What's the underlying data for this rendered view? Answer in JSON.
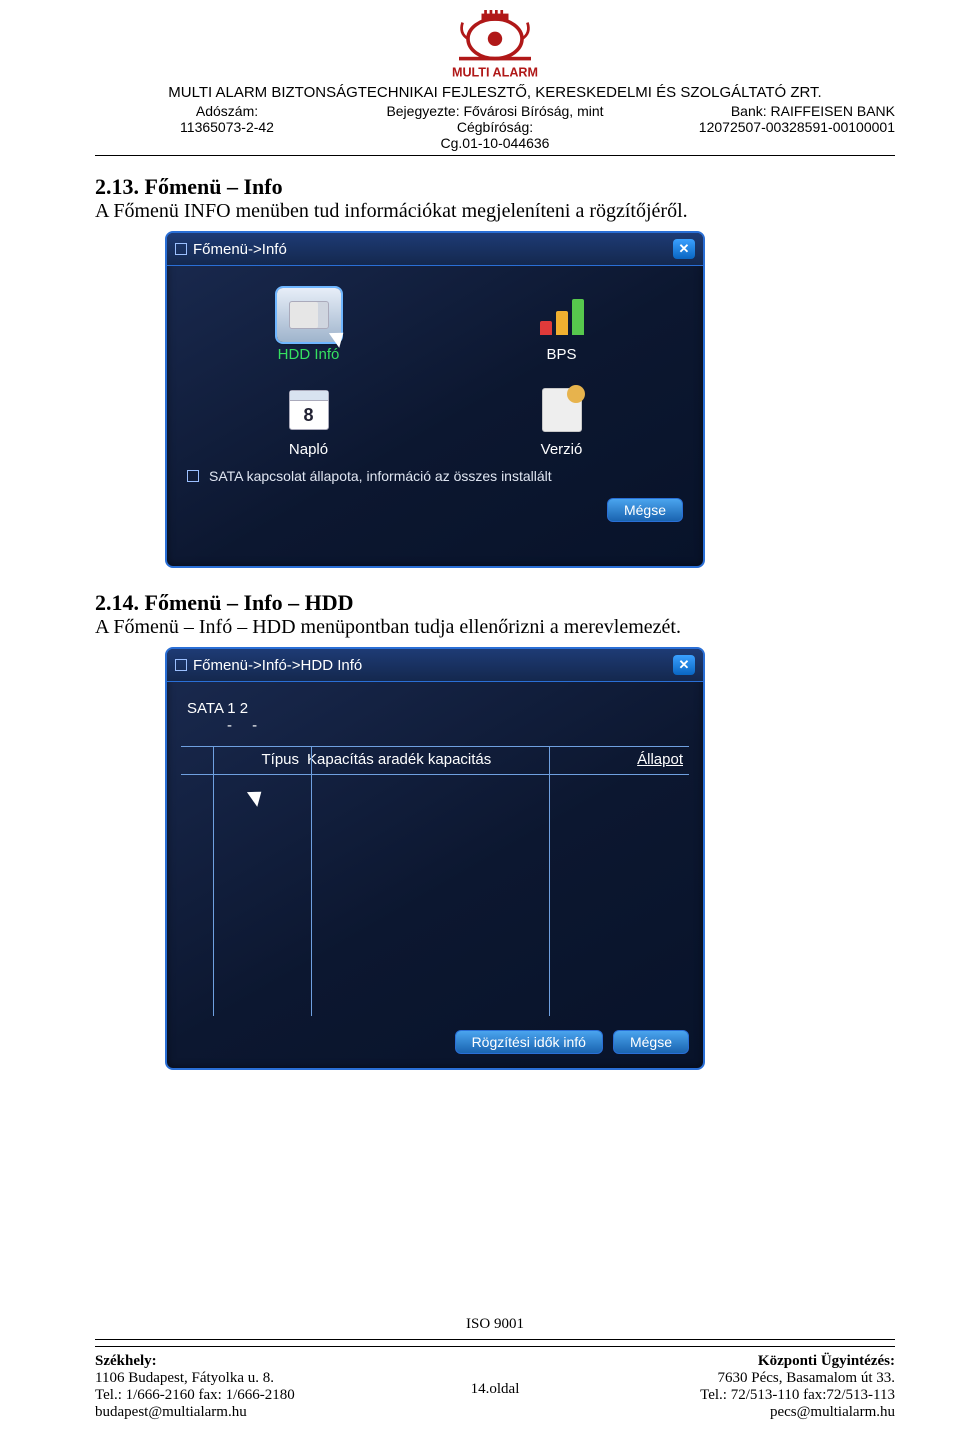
{
  "header": {
    "company_line": "MULTI ALARM  BIZTONSÁGTECHNIKAI FEJLESZTŐ, KERESKEDELMI ÉS SZOLGÁLTATÓ ZRT.",
    "left": {
      "l1": "Adószám:",
      "l2": "11365073-2-42"
    },
    "center": {
      "l1": "Bejegyezte: Fővárosi Bíróság, mint Cégbíróság:",
      "l2": "Cg.01-10-044636"
    },
    "right": {
      "l1": "Bank: RAIFFEISEN BANK",
      "l2": "12072507-00328591-00100001"
    },
    "logo_text": "MULTI ALARM"
  },
  "section213": {
    "title": "2.13. Főmenü – Info",
    "text": "A Főmenü INFO menüben tud információkat megjeleníteni a rögzítőjéről."
  },
  "win1": {
    "title": "Főmenü->Infó",
    "icons": {
      "hdd": "HDD Infó",
      "bps": "BPS",
      "naplo": "Napló",
      "cal_num": "8",
      "verzio": "Verzió"
    },
    "status": "SATA kapcsolat állapota, információ az összes installált",
    "cancel": "Mégse"
  },
  "section214": {
    "title": "2.14. Főmenü – Info – HDD",
    "text": "A Főmenü – Infó – HDD  menüpontban tudja ellenőrizni a merevlemezét."
  },
  "win2": {
    "title": "Főmenü->Infó->HDD Infó",
    "sata_label": "SATA  1   2",
    "sata_dash": "-   -",
    "th": {
      "c2": "Típus",
      "c3": "Kapacítás aradék kapacitás",
      "c4": "Állapot"
    },
    "btn1": "Rögzítési idők infó",
    "btn2": "Mégse"
  },
  "footer": {
    "iso": "ISO 9001",
    "page": "14.oldal",
    "left": {
      "h": "Székhely:",
      "l1": "1106 Budapest, Fátyolka u. 8.",
      "l2": "Tel.: 1/666-2160 fax: 1/666-2180",
      "l3": "budapest@multialarm.hu"
    },
    "right": {
      "h": "Központi Ügyintézés:",
      "l1": "7630 Pécs, Basamalom út 33.",
      "l2": "Tel.: 72/513-110 fax:72/513-113",
      "l3": "pecs@multialarm.hu"
    }
  }
}
